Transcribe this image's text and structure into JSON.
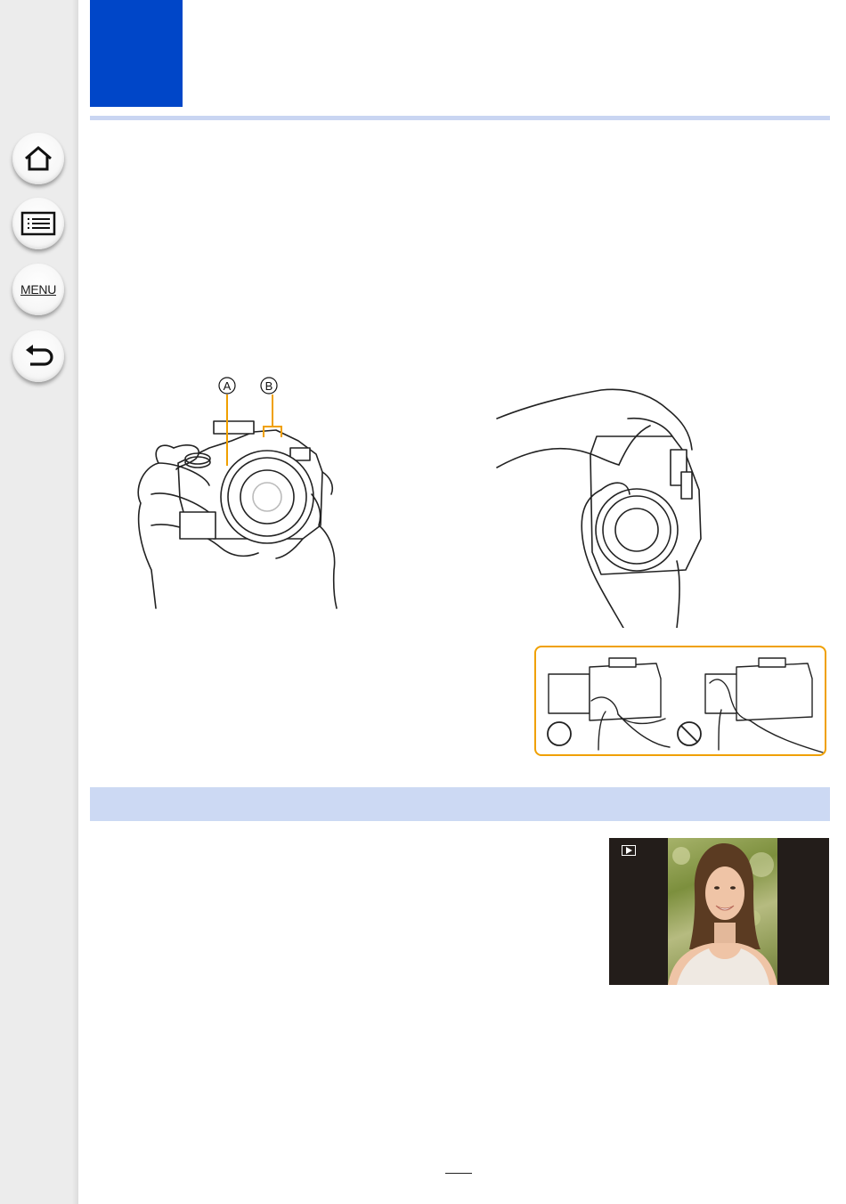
{
  "sidebar": {
    "items": [
      {
        "id": "home",
        "icon": "home-icon"
      },
      {
        "id": "contents",
        "icon": "list-icon"
      },
      {
        "id": "menu",
        "icon": "menu-icon",
        "label": "MENU"
      },
      {
        "id": "back",
        "icon": "back-arrow-icon"
      }
    ]
  },
  "colors": {
    "chapter_block": "#0046c8",
    "rule": "#c9d5f2",
    "section_band": "#ccd9f3",
    "callout_border": "#f0a000",
    "sidebar": "#ececec"
  },
  "figure_holding": {
    "label_a": "A",
    "label_b": "B",
    "leader_color": "#f0a000"
  },
  "callout": {
    "good_mark": "circle-ok-icon",
    "bad_mark": "prohibited-icon"
  },
  "playback_screen": {
    "mode_icon": "playback-icon"
  }
}
